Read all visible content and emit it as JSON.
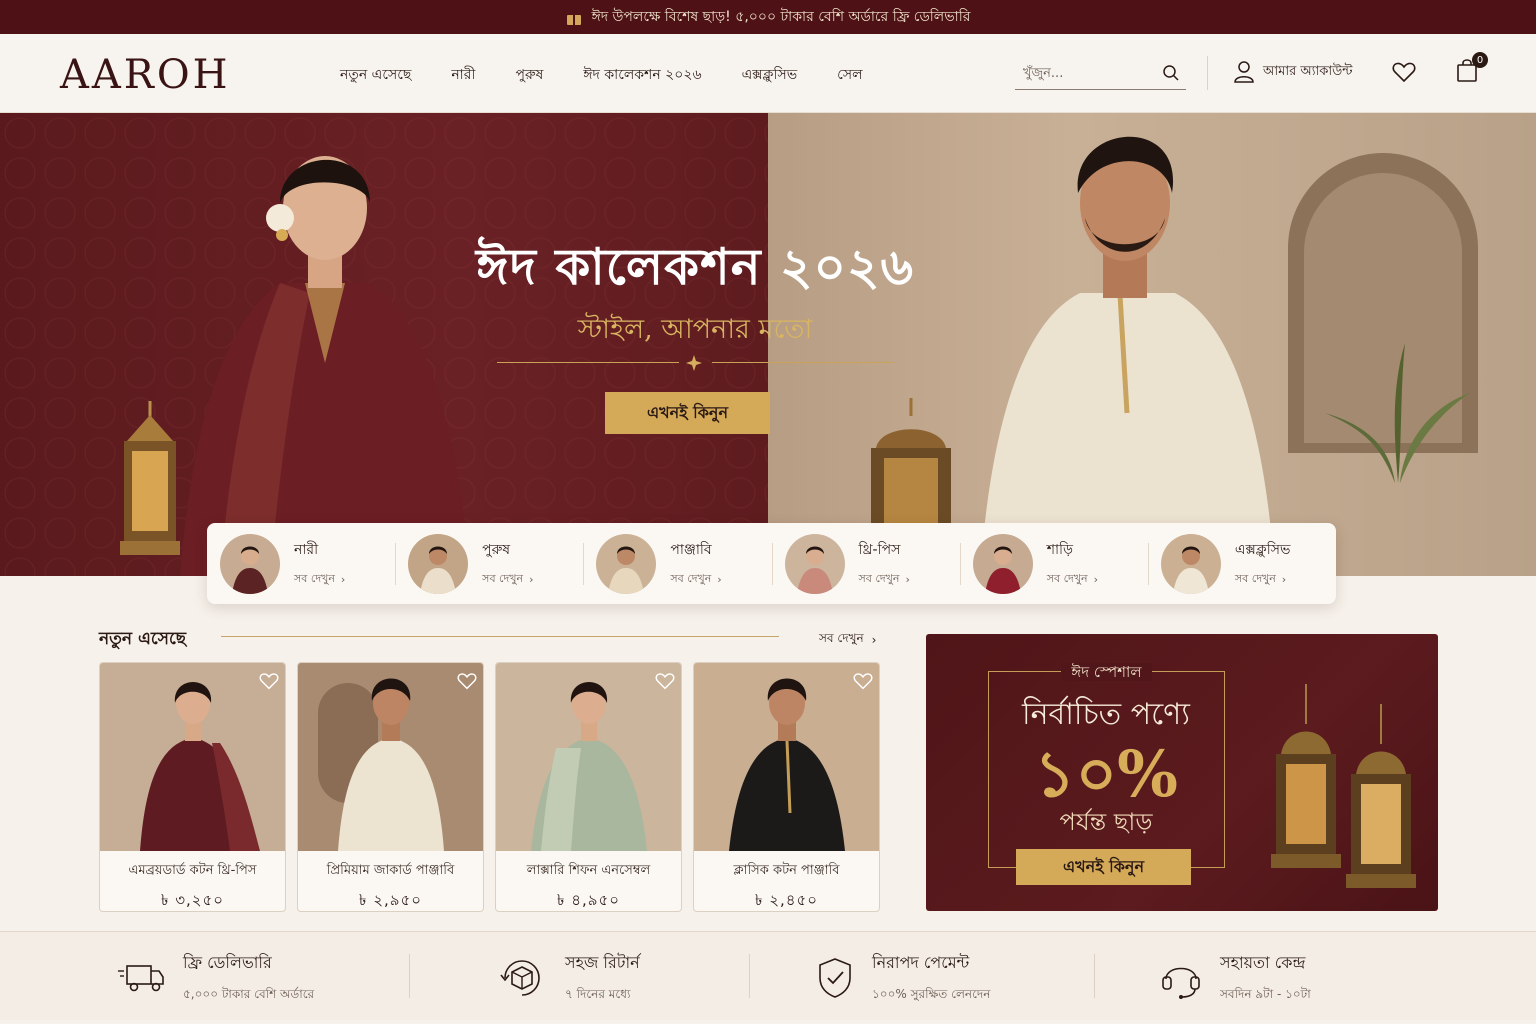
{
  "topbar": {
    "text": "ঈদ উপলক্ষে বিশেষ ছাড়! ৫,০০০ টাকার বেশি অর্ডারে ফ্রি ডেলিভারি",
    "icon": "gift-icon"
  },
  "header": {
    "logo": "AAROH",
    "nav": [
      "নতুন এসেছে",
      "নারী",
      "পুরুষ",
      "ঈদ কালেকশন ২০২৬",
      "এক্সক্লুসিভ",
      "সেল"
    ],
    "search_placeholder": "খুঁজুন...",
    "account_label": "আমার অ্যাকাউন্ট",
    "cart_count": "0"
  },
  "hero": {
    "title": "ঈদ কালেকশন ২০২৬",
    "subtitle": "স্টাইল, আপনার মতো",
    "cta": "এখনই কিনুন"
  },
  "categories": [
    {
      "name": "নারী",
      "link": "সব দেখুন"
    },
    {
      "name": "পুরুষ",
      "link": "সব দেখুন"
    },
    {
      "name": "পাঞ্জাবি",
      "link": "সব দেখুন"
    },
    {
      "name": "থ্রি-পিস",
      "link": "সব দেখুন"
    },
    {
      "name": "শাড়ি",
      "link": "সব দেখুন"
    },
    {
      "name": "এক্সক্লুসিভ",
      "link": "সব দেখুন"
    }
  ],
  "new_arrivals": {
    "title": "নতুন এসেছে",
    "view_all": "সব দেখুন",
    "products": [
      {
        "name": "এমব্রয়ডার্ড কটন থ্রি-পিস",
        "price": "৳ ৩,২৫০"
      },
      {
        "name": "প্রিমিয়াম জাকার্ড পাঞ্জাবি",
        "price": "৳ ২,৯৫০"
      },
      {
        "name": "লাক্সারি শিফন এনসেম্বল",
        "price": "৳ ৪,৯৫০"
      },
      {
        "name": "ক্লাসিক কটন পাঞ্জাবি",
        "price": "৳ ২,৪৫০"
      }
    ]
  },
  "promo": {
    "tag": "ঈদ স্পেশাল",
    "line1": "নির্বাচিত পণ্যে",
    "discount": "১০%",
    "line2": "পর্যন্ত ছাড়",
    "cta": "এখনই কিনুন"
  },
  "features": [
    {
      "title": "ফ্রি ডেলিভারি",
      "sub": "৫,০০০ টাকার বেশি অর্ডারে",
      "icon": "truck-icon"
    },
    {
      "title": "সহজ রিটার্ন",
      "sub": "৭ দিনের মধ্যে",
      "icon": "return-box-icon"
    },
    {
      "title": "নিরাপদ পেমেন্ট",
      "sub": "১০০% সুরক্ষিত লেনদেন",
      "icon": "shield-check-icon"
    },
    {
      "title": "সহায়তা কেন্দ্র",
      "sub": "সবদিন ৯টা - ১০টা",
      "icon": "headset-icon"
    }
  ],
  "colors": {
    "maroon": "#4e1216",
    "gold": "#d4aa59",
    "cream": "#f6f1ea"
  }
}
